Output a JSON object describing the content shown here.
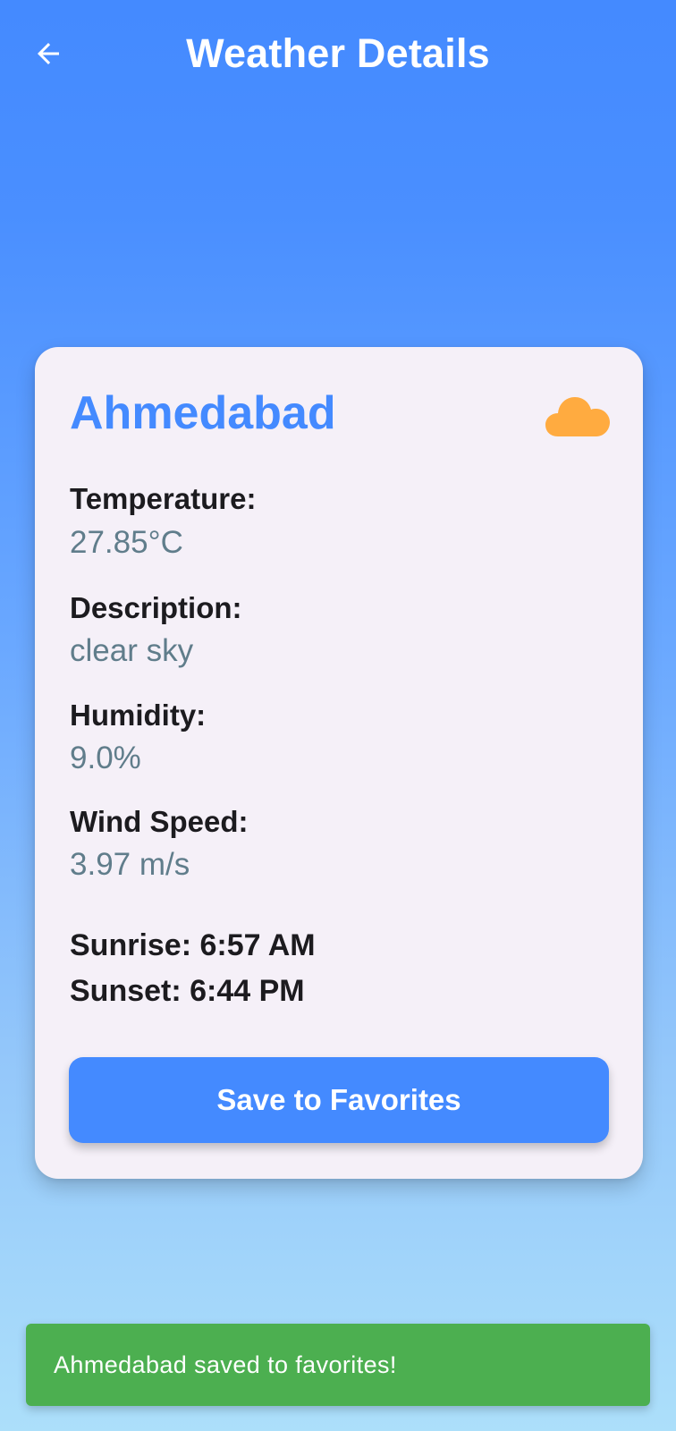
{
  "app_bar": {
    "title": "Weather Details",
    "back_icon": "arrow-left-icon"
  },
  "card": {
    "city": "Ahmedabad",
    "weather_icon": "cloud-icon",
    "weather_icon_color": "#FFAB40",
    "temperature": {
      "label": "Temperature:",
      "value": "27.85°C"
    },
    "description": {
      "label": "Description:",
      "value": "clear sky"
    },
    "humidity": {
      "label": "Humidity:",
      "value": "9.0%"
    },
    "wind_speed": {
      "label": "Wind Speed:",
      "value": "3.97 m/s"
    },
    "sunrise": "Sunrise: 6:57 AM",
    "sunset": "Sunset: 6:44 PM",
    "save_button_label": "Save to Favorites"
  },
  "snackbar": {
    "message": "Ahmedabad saved to favorites!",
    "color": "#4CAF50"
  },
  "colors": {
    "primary": "#448AFF",
    "card_background": "#F5F0F8",
    "value_text": "#607D8B"
  }
}
